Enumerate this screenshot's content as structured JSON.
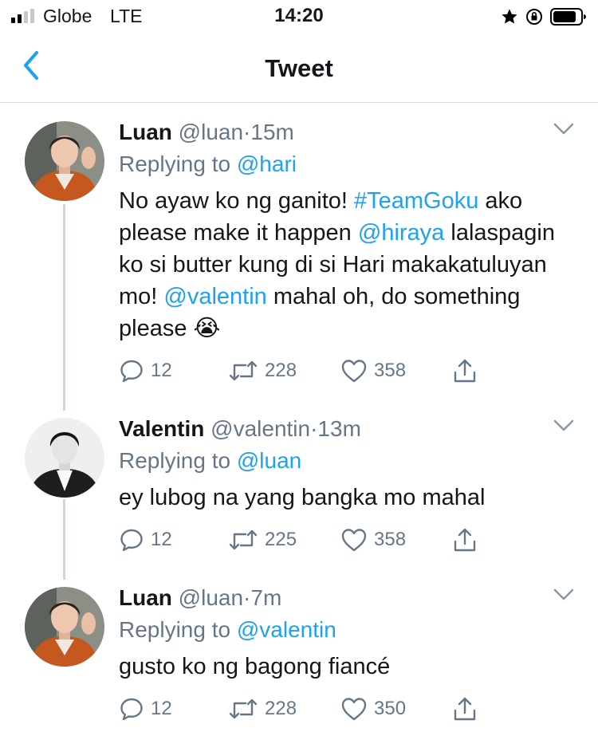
{
  "status_bar": {
    "carrier": "Globe",
    "network": "LTE",
    "time": "14:20"
  },
  "nav": {
    "title": "Tweet"
  },
  "colors": {
    "link": "#1da1f2",
    "muted": "#657786",
    "text": "#14171a",
    "thread_line": "#ccd6dd"
  },
  "tweets": [
    {
      "name": "Luan",
      "handle": "@luan",
      "separator": "·",
      "time": "15m",
      "replying_prefix": "Replying to",
      "replying_to": "@hari",
      "text_parts": [
        "No ayaw ko ng ganito! ",
        "#TeamGoku",
        " ako please make it happen ",
        "@hiraya",
        " lalaspagin ko si butter kung di si Hari makakatuluyan mo! ",
        "@valentin",
        " mahal oh, do something please 😭"
      ],
      "replies": "12",
      "retweets": "228",
      "likes": "358",
      "avatar_icon": "luan-avatar"
    },
    {
      "name": "Valentin",
      "handle": "@valentin",
      "separator": "·",
      "time": "13m",
      "replying_prefix": "Replying to",
      "replying_to": "@luan",
      "text": "ey lubog na yang bangka mo mahal",
      "replies": "12",
      "retweets": "225",
      "likes": "358",
      "avatar_icon": "valentin-avatar"
    },
    {
      "name": "Luan",
      "handle": "@luan",
      "separator": "·",
      "time": "7m",
      "replying_prefix": "Replying to",
      "replying_to": "@valentin",
      "text": "gusto ko ng bagong fiancé",
      "replies": "12",
      "retweets": "228",
      "likes": "350",
      "avatar_icon": "luan-avatar"
    }
  ]
}
